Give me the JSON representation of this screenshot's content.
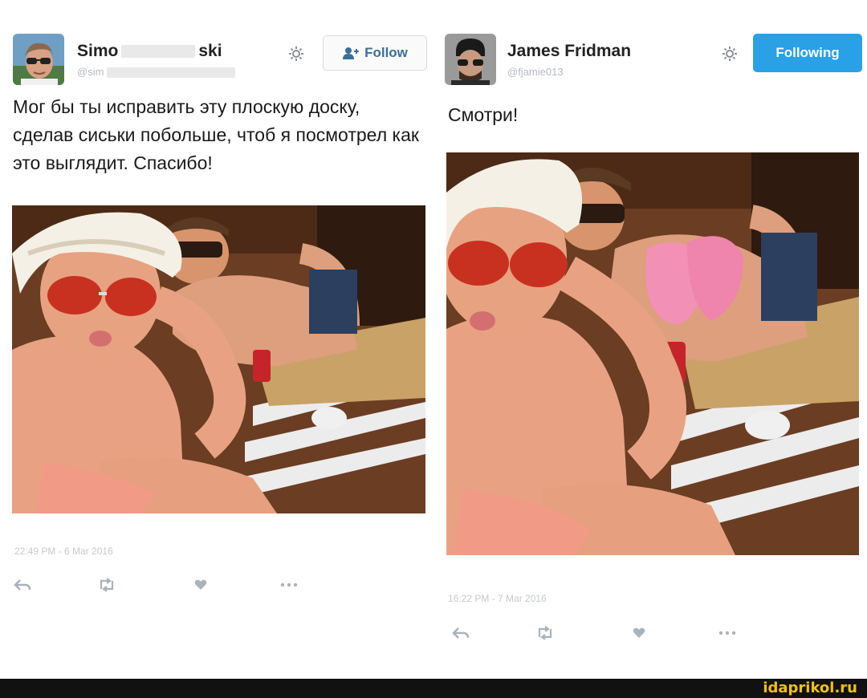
{
  "left_tweet": {
    "user_name_start": "Simo",
    "user_name_end": "ski",
    "user_handle": "@sim",
    "follow_label": "Follow",
    "text": "Мог бы ты исправить эту плоскую доску, сделав сиськи побольше, чтоб я посмотрел как это выглядит. Спасибо!",
    "timestamp": "22:49 PM - 6 Mar 2016",
    "icons": [
      "reply-icon",
      "retweet-icon",
      "like-icon",
      "more-icon"
    ]
  },
  "right_tweet": {
    "user_name": "James Fridman",
    "user_handle": "@fjamie013",
    "following_label": "Following",
    "text": "Смотри!",
    "timestamp": "16:22 PM - 7 Mar 2016",
    "icons": [
      "reply-icon",
      "retweet-icon",
      "like-icon",
      "more-icon"
    ]
  },
  "footer": {
    "watermark": "idaprikol.ru"
  },
  "colors": {
    "following_button": "#2aa0e6",
    "follow_text": "#3b6f9c",
    "watermark": "#f2c200",
    "footer_bar": "#111111"
  }
}
